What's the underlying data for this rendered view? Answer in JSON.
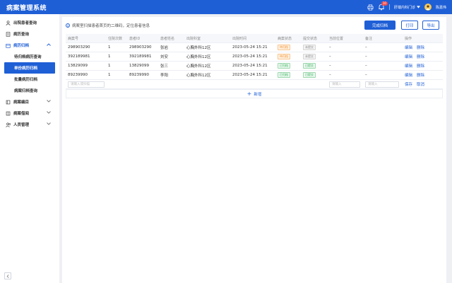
{
  "app": {
    "title": "病案管理系统"
  },
  "topbar": {
    "badge": "10",
    "department": "肝端内科门诊",
    "user": "陈嘉伟"
  },
  "sidebar": {
    "items": [
      {
        "label": "出院患者查询"
      },
      {
        "label": "病历查询"
      },
      {
        "label": "病历归档",
        "open": true,
        "children": [
          {
            "label": "待归档病历查询"
          },
          {
            "label": "单份病历归档",
            "active": true
          },
          {
            "label": "批量病历归档"
          },
          {
            "label": "病案归档查询"
          }
        ]
      },
      {
        "label": "病案编目"
      },
      {
        "label": "病案借阅"
      },
      {
        "label": "人员管理"
      }
    ]
  },
  "panel": {
    "hint": "病案室扫描患者首页的二维码，定位患者信息",
    "buttons": {
      "complete": "完成归档",
      "print": "打印",
      "export": "导出"
    },
    "columns": [
      "病案号",
      "住院次数",
      "患者ID",
      "患者姓名",
      "出院科室",
      "出院时间",
      "病案状态",
      "提交状态",
      "当前位置",
      "备注",
      "操作"
    ],
    "rows": [
      {
        "record_no": "298903290",
        "times": "1",
        "patient_id": "298903290",
        "name": "张岩",
        "dept": "心胸外科12区",
        "time": "2023-05-24 15:21",
        "status": "待归档",
        "status_color": "orange",
        "submit": "未提交",
        "submit_color": "gray",
        "location": "–",
        "note": "–",
        "edit": "编辑",
        "delete": "删除"
      },
      {
        "record_no": "392189981",
        "times": "1",
        "patient_id": "392189981",
        "name": "刘安",
        "dept": "心胸外科12区",
        "time": "2023-05-24 15:21",
        "status": "待归档",
        "status_color": "orange",
        "submit": "未提交",
        "submit_color": "gray",
        "location": "–",
        "note": "–",
        "edit": "编辑",
        "delete": "删除"
      },
      {
        "record_no": "13829099",
        "times": "1",
        "patient_id": "13829099",
        "name": "张三",
        "dept": "心胸外科12区",
        "time": "2023-05-24 15:21",
        "status": "已归档",
        "status_color": "green",
        "submit": "已提交",
        "submit_color": "green",
        "location": "–",
        "note": "–",
        "edit": "编辑",
        "delete": "删除"
      },
      {
        "record_no": "89239990",
        "times": "1",
        "patient_id": "89239990",
        "name": "李阳",
        "dept": "心胸外科12区",
        "time": "2023-05-24 15:21",
        "status": "已归档",
        "status_color": "green",
        "submit": "已提交",
        "submit_color": "green",
        "location": "–",
        "note": "–",
        "edit": "编辑",
        "delete": "删除"
      }
    ],
    "new_row": {
      "scan_placeholder": "请输入或扫描",
      "location_placeholder": "请输入",
      "note_placeholder": "请输入",
      "save": "保存",
      "cancel": "取消"
    },
    "add_label": "新增"
  },
  "colors": {
    "primary": "#1f5fd6",
    "pending": "#f08a24",
    "done": "#2fae55"
  }
}
